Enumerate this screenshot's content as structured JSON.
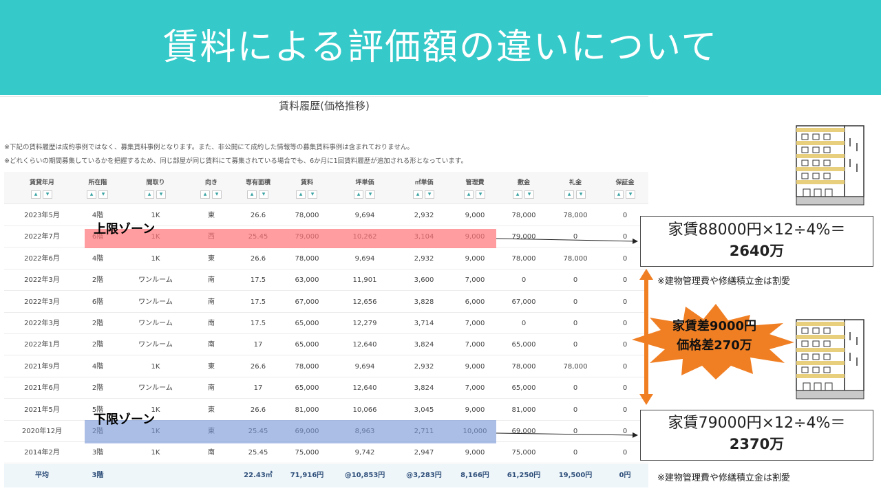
{
  "slide": {
    "title": "賃料による評価額の違いについて"
  },
  "panel": {
    "title": "賃料履歴(価格推移)",
    "note1": "※下記の賃料履歴は成約事例ではなく、募集賃料事例となります。また、非公開にて成約した情報等の募集賃料事例は含まれておりません。",
    "note2": "※どれくらいの期間募集しているかを把握するため、同じ部屋が同じ賃料にて募集されている場合でも、6か月に1回賃料履歴が追加される形となっています。"
  },
  "table": {
    "headers": [
      "賃貸年月",
      "所在階",
      "間取り",
      "向き",
      "専有面積",
      "賃料",
      "坪単価",
      "㎡単価",
      "管理費",
      "敷金",
      "礼金",
      "保証金"
    ],
    "rows": [
      [
        "2023年5月",
        "4階",
        "1K",
        "東",
        "26.6",
        "78,000",
        "9,694",
        "2,932",
        "9,000",
        "78,000",
        "78,000",
        "0"
      ],
      [
        "2022年7月",
        "6階",
        "1K",
        "西",
        "25.45",
        "79,000",
        "10,262",
        "3,104",
        "9,000",
        "79,000",
        "0",
        "0"
      ],
      [
        "2022年6月",
        "4階",
        "1K",
        "東",
        "26.6",
        "78,000",
        "9,694",
        "2,932",
        "9,000",
        "78,000",
        "78,000",
        "0"
      ],
      [
        "2022年3月",
        "2階",
        "ワンルーム",
        "南",
        "17.5",
        "63,000",
        "11,901",
        "3,600",
        "7,000",
        "0",
        "0",
        "0"
      ],
      [
        "2022年3月",
        "6階",
        "ワンルーム",
        "南",
        "17.5",
        "67,000",
        "12,656",
        "3,828",
        "6,000",
        "67,000",
        "0",
        "0"
      ],
      [
        "2022年3月",
        "2階",
        "ワンルーム",
        "南",
        "17.5",
        "65,000",
        "12,279",
        "3,714",
        "7,000",
        "0",
        "0",
        "0"
      ],
      [
        "2022年1月",
        "2階",
        "ワンルーム",
        "南",
        "17",
        "65,000",
        "12,640",
        "3,824",
        "7,000",
        "65,000",
        "0",
        "0"
      ],
      [
        "2021年9月",
        "4階",
        "1K",
        "東",
        "26.6",
        "78,000",
        "9,694",
        "2,932",
        "9,000",
        "78,000",
        "78,000",
        "0"
      ],
      [
        "2021年6月",
        "2階",
        "ワンルーム",
        "南",
        "17",
        "65,000",
        "12,640",
        "3,824",
        "7,000",
        "65,000",
        "0",
        "0"
      ],
      [
        "2021年5月",
        "5階",
        "1K",
        "東",
        "26.6",
        "81,000",
        "10,066",
        "3,045",
        "9,000",
        "81,000",
        "0",
        "0"
      ],
      [
        "2020年12月",
        "2階",
        "1K",
        "東",
        "25.45",
        "69,000",
        "8,963",
        "2,711",
        "10,000",
        "69,000",
        "0",
        "0"
      ],
      [
        "2014年2月",
        "3階",
        "1K",
        "南",
        "25.45",
        "75,000",
        "9,742",
        "2,947",
        "9,000",
        "75,000",
        "0",
        "0"
      ]
    ],
    "average": [
      "平均",
      "3階",
      "",
      "",
      "22.43㎡",
      "71,916円",
      "@10,853円",
      "@3,283円",
      "8,166円",
      "61,250円",
      "19,500円",
      "0円"
    ]
  },
  "zones": {
    "upper": "上限ゾーン",
    "lower": "下限ゾーン"
  },
  "calc_upper": {
    "line1": "家賃88000円×12÷4%＝",
    "line2": "2640万",
    "note": "※建物管理費や修繕積立金は割愛"
  },
  "calc_lower": {
    "line1": "家賃79000円×12÷4%＝",
    "line2": "2370万",
    "note": "※建物管理費や修繕積立金は割愛"
  },
  "burst": {
    "line1": "家賃差9000円",
    "line2": "価格差270万"
  },
  "colors": {
    "header": "#35c9c9",
    "burst": "#f07f24",
    "upper_zone": "#ff7378",
    "lower_zone": "#7896d7"
  },
  "icons": [
    "building-icon",
    "building-icon"
  ]
}
